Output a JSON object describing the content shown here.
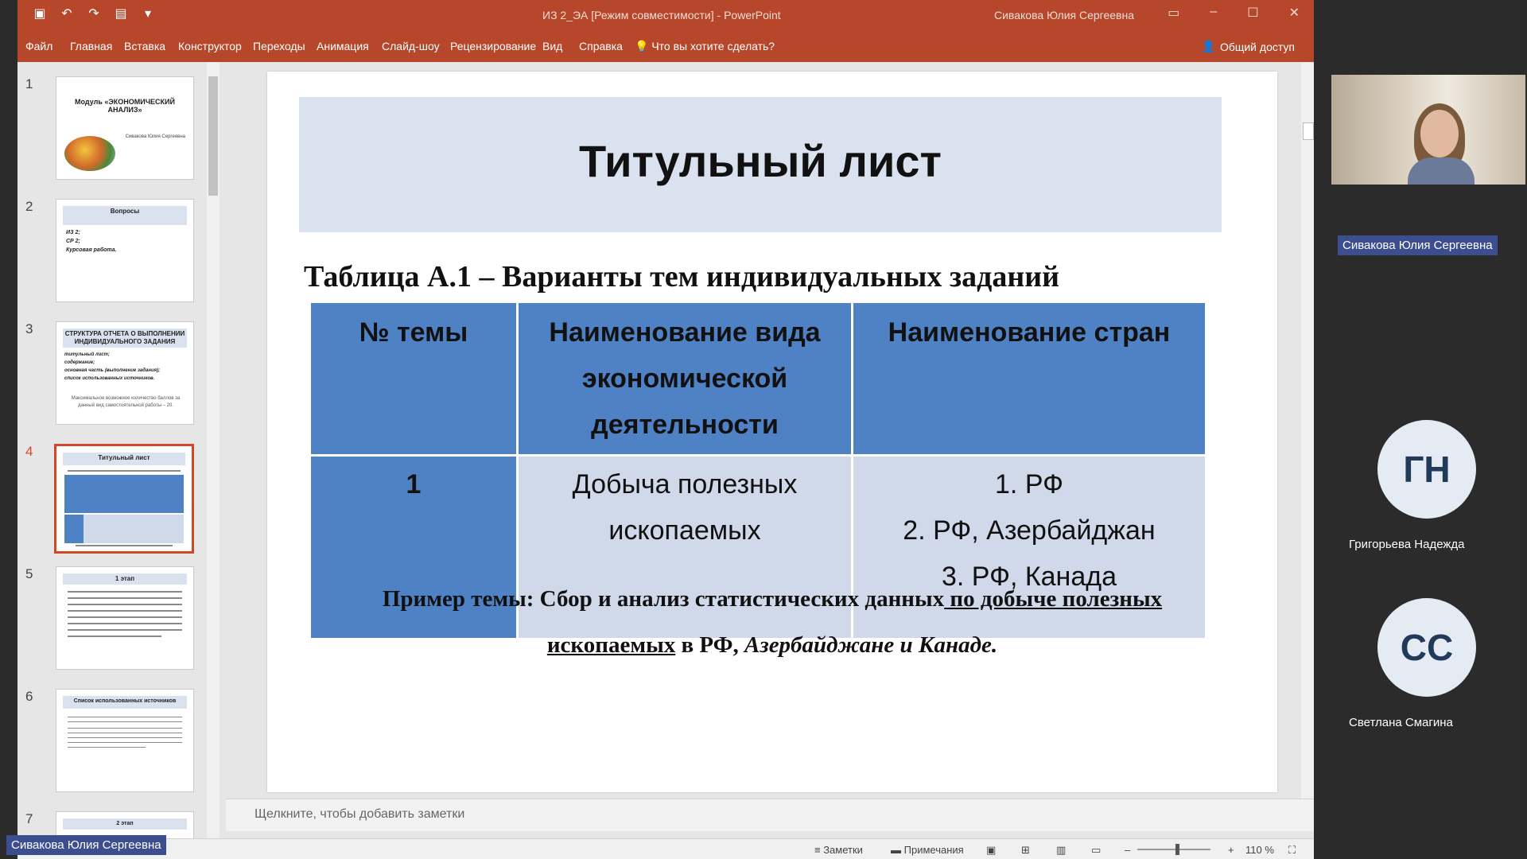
{
  "window": {
    "title": "ИЗ 2_ЭА [Режим совместимости]",
    "app": "PowerPoint",
    "user": "Сивакова Юлия Сергеевна"
  },
  "menu": {
    "items": [
      "Файл",
      "Главная",
      "Вставка",
      "Конструктор",
      "Переходы",
      "Анимация",
      "Слайд-шоу",
      "Рецензирование",
      "Вид",
      "Справка"
    ],
    "search": "Что вы хотите сделать?",
    "share": "Общий доступ"
  },
  "thumbnails": [
    {
      "num": "1",
      "title": "Модуль «ЭКОНОМИЧЕСКИЙ АНАЛИЗ»",
      "sub": "Сивакова Юлия Сергеевна"
    },
    {
      "num": "2",
      "title": "Вопросы",
      "items": [
        "ИЗ 2;",
        "СР 2;",
        "Курсовая работа."
      ]
    },
    {
      "num": "3",
      "title": "СТРУКТУРА ОТЧЕТА О ВЫПОЛНЕНИИ ИНДИВИДУАЛЬНОГО ЗАДАНИЯ",
      "items": [
        "титульный лист;",
        "содержание;",
        "основная часть (выполнение задания);",
        "список использованных источников."
      ],
      "note": "Максимальное возможное количество баллов за данный вид самостоятельной работы – 20."
    },
    {
      "num": "4",
      "title": "Титульный лист"
    },
    {
      "num": "5",
      "title": "1 этап"
    },
    {
      "num": "6",
      "title": "Список использованных источников"
    },
    {
      "num": "7",
      "title": "2 этап"
    }
  ],
  "slide": {
    "title": "Титульный лист",
    "caption": "Таблица А.1 – Варианты тем индивидуальных заданий",
    "table": {
      "headers": [
        "№ темы",
        "Наименование вида экономической деятельности",
        "Наименование стран"
      ],
      "row": {
        "num": "1",
        "activity": "Добыча полезных ископаемых",
        "countries": [
          "1. РФ",
          "2. РФ, Азербайджан",
          "3. РФ, Канада"
        ]
      }
    },
    "example": {
      "prefix": "Пример темы: Сбор и анализ статистических данных",
      "underlined": " по добыче полезных ископаемых",
      "middle": " в  РФ, ",
      "italic": "Азербайджане и Канаде."
    }
  },
  "notes_placeholder": "Щелкните, чтобы добавить заметки",
  "status": {
    "notes": "Заметки",
    "comments": "Примечания",
    "zoom": "110 %"
  },
  "participants": {
    "presenter": "Сивакова Юлия Сергеевна",
    "others": [
      {
        "initials": "ГН",
        "name": "Григорьева Надежда"
      },
      {
        "initials": "СС",
        "name": "Светлана Смагина"
      }
    ],
    "screen_owner": "Сивакова Юлия Сергеевна"
  },
  "colors": {
    "ribbon": "#b7472a",
    "table_header": "#4f81c5",
    "table_cell": "#cfd9ea",
    "title_box": "#d9e2ee"
  }
}
